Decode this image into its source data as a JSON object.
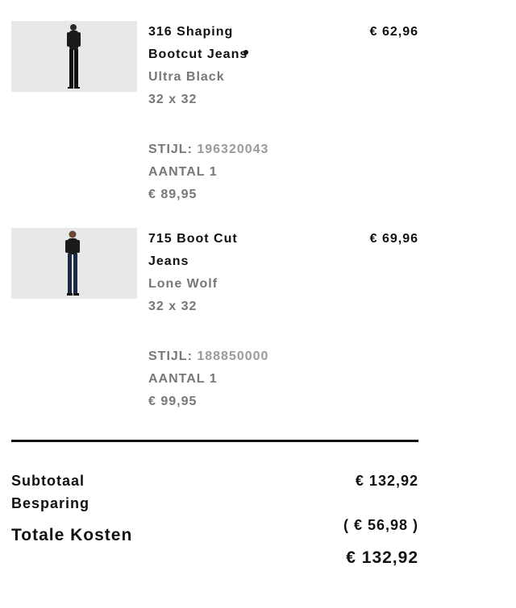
{
  "cart": {
    "items": [
      {
        "name": "316 Shaping Bootcut Jeans",
        "color": "Ultra Black",
        "size": "32 x 32",
        "style_label": "STIJL:",
        "style_number": "196320043",
        "quantity": "AANTAL 1",
        "original_price": "€ 89,95",
        "price": "€ 62,96",
        "image": "product-photo-woman-black-jeans"
      },
      {
        "name": "715 Boot Cut Jeans",
        "color": "Lone Wolf",
        "size": "32 x 32",
        "style_label": "STIJL:",
        "style_number": "188850000",
        "quantity": "AANTAL 1",
        "original_price": "€ 99,95",
        "price": "€ 69,96",
        "image": "product-photo-woman-dark-jeans"
      }
    ]
  },
  "summary": {
    "subtotal_label": "Subtotaal",
    "subtotal_value": "€ 132,92",
    "savings_label": "Besparing",
    "savings_value": "( € 56,98 )",
    "total_label": "Totale Kosten",
    "total_value": "€ 132,92"
  },
  "colors": {
    "text": "#111111",
    "muted": "#777777",
    "light": "#9b9b9b",
    "image_bg": "#e8e8e8"
  }
}
